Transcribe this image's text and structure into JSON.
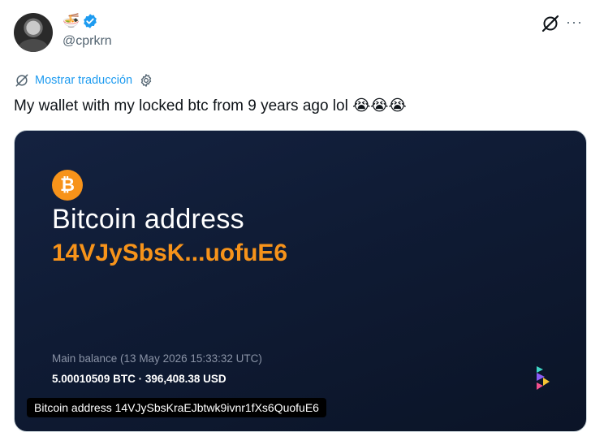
{
  "author": {
    "name_emoji": "🍜",
    "handle": "@cprkrn",
    "verified_color": "#1d9bf0"
  },
  "header": {
    "grok_icon": "grok-icon",
    "more_label": "···"
  },
  "translation": {
    "link_label": "Mostrar traducción",
    "icons": [
      "translate-icon",
      "gear-icon"
    ],
    "link_color": "#1d9bf0"
  },
  "tweet": {
    "text": "My wallet with my locked btc from 9 years ago lol",
    "emojis": "😭😭😭"
  },
  "card": {
    "logo_glyph": "₿",
    "title": "Bitcoin address",
    "address_short": "14VJySbsK...uofuE6",
    "balance_label": "Main balance (13 May 2026 15:33:32 UTC)",
    "balance_value": "5.00010509 BTC · 396,408.38 USD",
    "alt_caption": "Bitcoin address 14VJySbsKraEJbtwk9ivnr1fXs6QuofuE6",
    "colors": {
      "accent": "#f7931a",
      "background": "#0f1b34"
    }
  }
}
